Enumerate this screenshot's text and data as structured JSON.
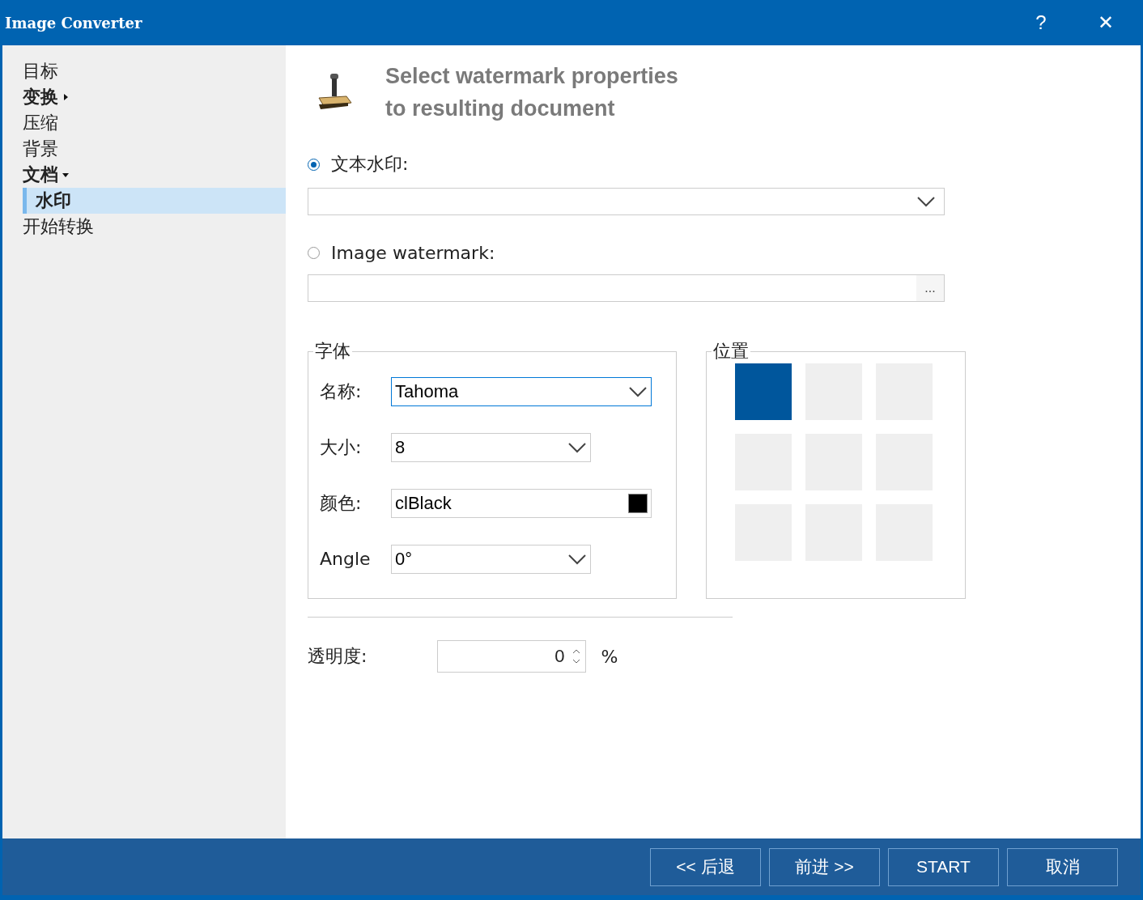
{
  "window": {
    "title": "Image Converter",
    "help": "?",
    "close": "✕"
  },
  "sidebar": {
    "items": [
      {
        "label": "目标",
        "kind": "leaf",
        "selected": false
      },
      {
        "label": "变换",
        "kind": "group",
        "expanded": false,
        "selected": false
      },
      {
        "label": "压缩",
        "kind": "leaf",
        "selected": false
      },
      {
        "label": "背景",
        "kind": "leaf",
        "selected": false
      },
      {
        "label": "文档",
        "kind": "group",
        "expanded": true,
        "selected": false,
        "children": [
          {
            "label": "水印",
            "kind": "leaf",
            "selected": true
          }
        ]
      },
      {
        "label": "开始转换",
        "kind": "leaf",
        "selected": false
      }
    ]
  },
  "header": {
    "title": "Select watermark properties\nto resulting document"
  },
  "text_watermark": {
    "label": "文本水印:",
    "selected": true
  },
  "image_watermark": {
    "label": "Image watermark:",
    "selected": false,
    "browse": "..."
  },
  "font": {
    "legend": "字体",
    "fields": [
      {
        "label": "名称:",
        "value": "Tahoma",
        "kind": "combo",
        "focused": true
      },
      {
        "label": "大小:",
        "value": "8",
        "kind": "combo",
        "focused": false
      },
      {
        "label": "颜色:",
        "value": "clBlack",
        "kind": "color",
        "color": "#000000",
        "focused": false
      },
      {
        "label": "Angle",
        "value": "0°",
        "kind": "combo",
        "focused": false
      }
    ]
  },
  "position": {
    "legend": "位置",
    "cells": [
      {
        "selected": true
      },
      {
        "selected": false
      },
      {
        "selected": false
      },
      {
        "selected": false
      },
      {
        "selected": false
      },
      {
        "selected": false
      },
      {
        "selected": false
      },
      {
        "selected": false
      },
      {
        "selected": false
      }
    ]
  },
  "transparency": {
    "label": "透明度:",
    "value": "0",
    "unit": "%"
  },
  "buttons": [
    "<< 后退",
    "前进 >>",
    "START",
    "取消"
  ]
}
